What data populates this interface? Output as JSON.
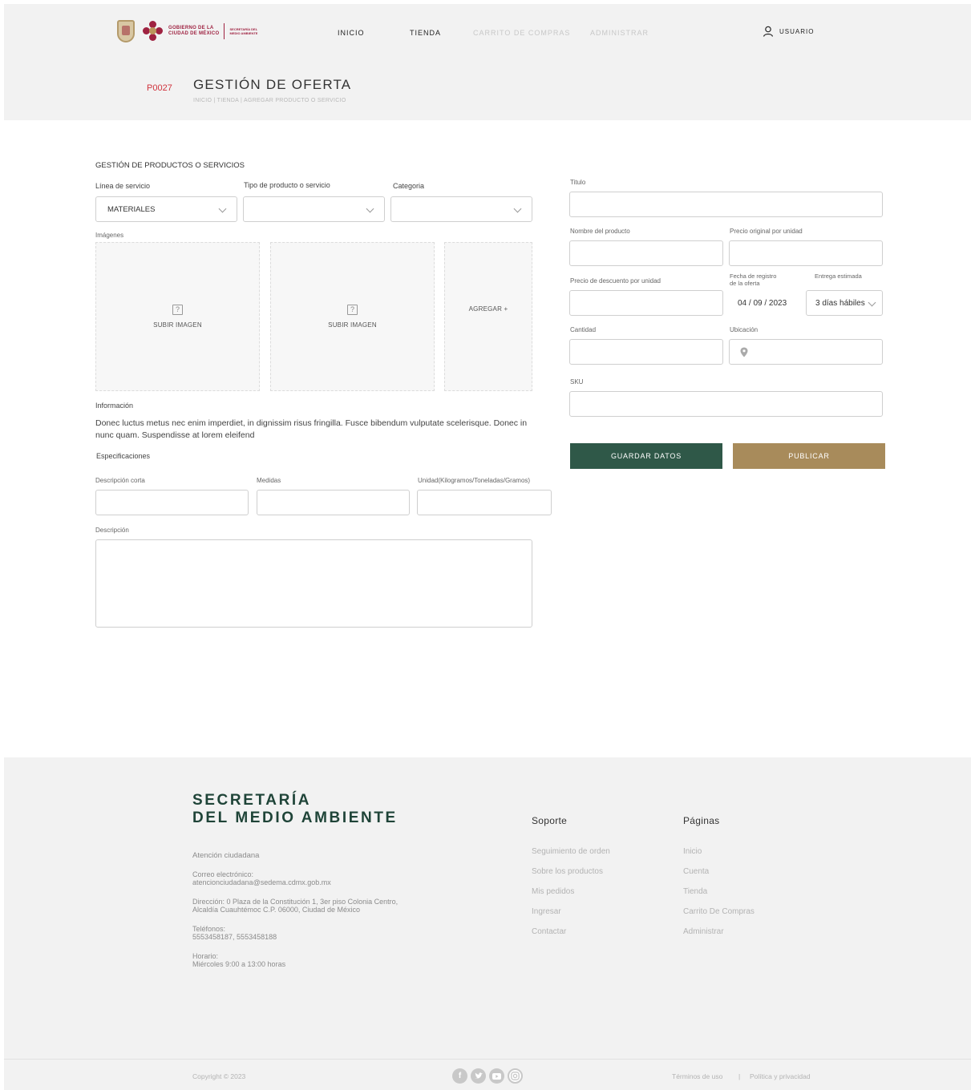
{
  "header": {
    "logo": {
      "gov_line1": "GOBIERNO DE LA",
      "gov_line2": "CIUDAD DE MÉXICO",
      "sec_line1": "SECRETARÍA DEL",
      "sec_line2": "MEDIO AMBIENTE"
    },
    "nav": [
      {
        "label": "INICIO",
        "enabled": true
      },
      {
        "label": "TIENDA",
        "enabled": true
      },
      {
        "label": "CARRITO DE COMPRAS",
        "enabled": false
      },
      {
        "label": "ADMINISTRAR",
        "enabled": false
      }
    ],
    "user_label": "USUARIO",
    "page_code": "P0027",
    "page_title": "GESTIÓN DE OFERTA",
    "breadcrumb": "INICIO | TIENDA | AGREGAR PRODUCTO O SERVICIO"
  },
  "form": {
    "section_title": "GESTIÓN DE PRODUCTOS O SERVICIOS",
    "linea_label": "Línea de servicio",
    "linea_value": "MATERIALES",
    "tipo_label": "Tipo de producto o servicio",
    "tipo_value": "",
    "categoria_label": "Categoria",
    "categoria_value": "",
    "imagenes_label": "Imágenes",
    "upload_label_1": "SUBIR IMAGEN",
    "upload_label_2": "SUBIR IMAGEN",
    "add_label": "AGREGAR +",
    "info_label": "Información",
    "info_text": "Donec luctus metus nec enim imperdiet, in dignissim risus fringilla. Fusce bibendum vulputate scelerisque. Donec in nunc quam. Suspendisse at lorem eleifend",
    "especificaciones_label": "Especificaciones",
    "descripcion_corta_label": "Descripción corta",
    "medidas_label": "Medidas",
    "unidad_label": "Unidad(Kilogramos/Toneladas/Gramos)",
    "descripcion_label": "Descripción",
    "titulo_label": "Titulo",
    "nombre_label": "Nombre del producto",
    "precio_original_label": "Precio original por unidad",
    "precio_descuento_label": "Precio de descuento por unidad",
    "fecha_label_1": "Fecha de registro",
    "fecha_label_2": "de la oferta",
    "fecha_value": "04 / 09 / 2023",
    "entrega_label": "Entrega estimada",
    "entrega_value": "3 días hábiles",
    "cantidad_label": "Cantidad",
    "ubicacion_label": "Ubicación",
    "sku_label": "SKU",
    "save_label": "GUARDAR DATOS",
    "publish_label": "PUBLICAR"
  },
  "footer": {
    "brand_line1": "SECRETARÍA",
    "brand_line2": "DEL MEDIO AMBIENTE",
    "atencion": "Atención ciudadana",
    "correo_label": "Correo electrónico:",
    "correo_value": "atencionciudadana@sedema.cdmx.gob.mx",
    "direccion_line1": "Dirección: 0 Plaza de la Constitución 1, 3er piso Colonia Centro,",
    "direccion_line2": "Alcaldía Cuauhtémoc C.P. 06000, Ciudad de México",
    "telefonos_label": "Teléfonos:",
    "telefonos_value": "5553458187, 5553458188",
    "horario_label": "Horario:",
    "horario_value": "Miércoles 9:00 a 13:00 horas",
    "soporte_title": "Soporte",
    "soporte_links": [
      "Seguimiento de orden",
      "Sobre los productos",
      "Mis pedidos",
      "Ingresar",
      "Contactar"
    ],
    "paginas_title": "Páginas",
    "paginas_links": [
      "Inicio",
      "Cuenta",
      "Tienda",
      "Carrito De Compras",
      "Administrar"
    ],
    "copyright": "Copyright © 2023",
    "socials": [
      "facebook-icon",
      "twitter-icon",
      "youtube-icon",
      "instagram-icon"
    ],
    "terminos": "Términos de uso",
    "separator": "|",
    "privacidad": "Política y privacidad"
  },
  "colors": {
    "brand_green": "#2f5848",
    "brand_gold": "#a88b5b",
    "brand_red": "#9f2241",
    "code_red": "#d0323c"
  }
}
